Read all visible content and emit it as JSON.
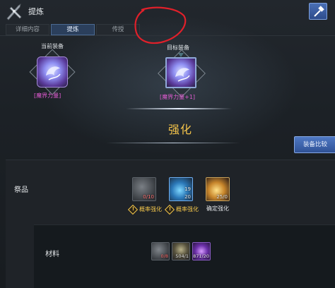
{
  "header": {
    "title": "提炼"
  },
  "tabs": [
    {
      "label": "详细内容",
      "active": false
    },
    {
      "label": "提炼",
      "active": true
    },
    {
      "label": "传授",
      "active": false
    }
  ],
  "current_equipment": {
    "label": "当前装备",
    "name": "[魔界力量]"
  },
  "target_equipment": {
    "label": "目标装备",
    "name": "[魔界力量+1]"
  },
  "enhance_title": "强化",
  "compare_button": "装备比较",
  "offering": {
    "label": "祭品",
    "slots": [
      {
        "count": "0/10",
        "count_color": "#ff7070",
        "label": "概率强化",
        "warn": true,
        "style": "gray"
      },
      {
        "count_top": "19",
        "count": "20",
        "label": "概率强化",
        "warn": true,
        "style": "blue"
      },
      {
        "count": "25/0",
        "label": "确定强化",
        "warn": false,
        "style": "gold"
      }
    ]
  },
  "material": {
    "label": "材料",
    "slots": [
      {
        "count": "0/8",
        "count_color": "#ff6a6a",
        "style": "gray"
      },
      {
        "count": "504/1",
        "style": "dark"
      },
      {
        "count": "871/20",
        "style": "purple"
      }
    ]
  },
  "colors": {
    "accent_title": "#f3c34a",
    "item_name": "#e05bd1",
    "button_blue": "#4f78c4",
    "annotation_red": "#e0202a"
  },
  "icons": {
    "app": "crossed-weapons-icon",
    "corner_button": "hammer-icon",
    "warning": "warning-diamond-icon"
  }
}
